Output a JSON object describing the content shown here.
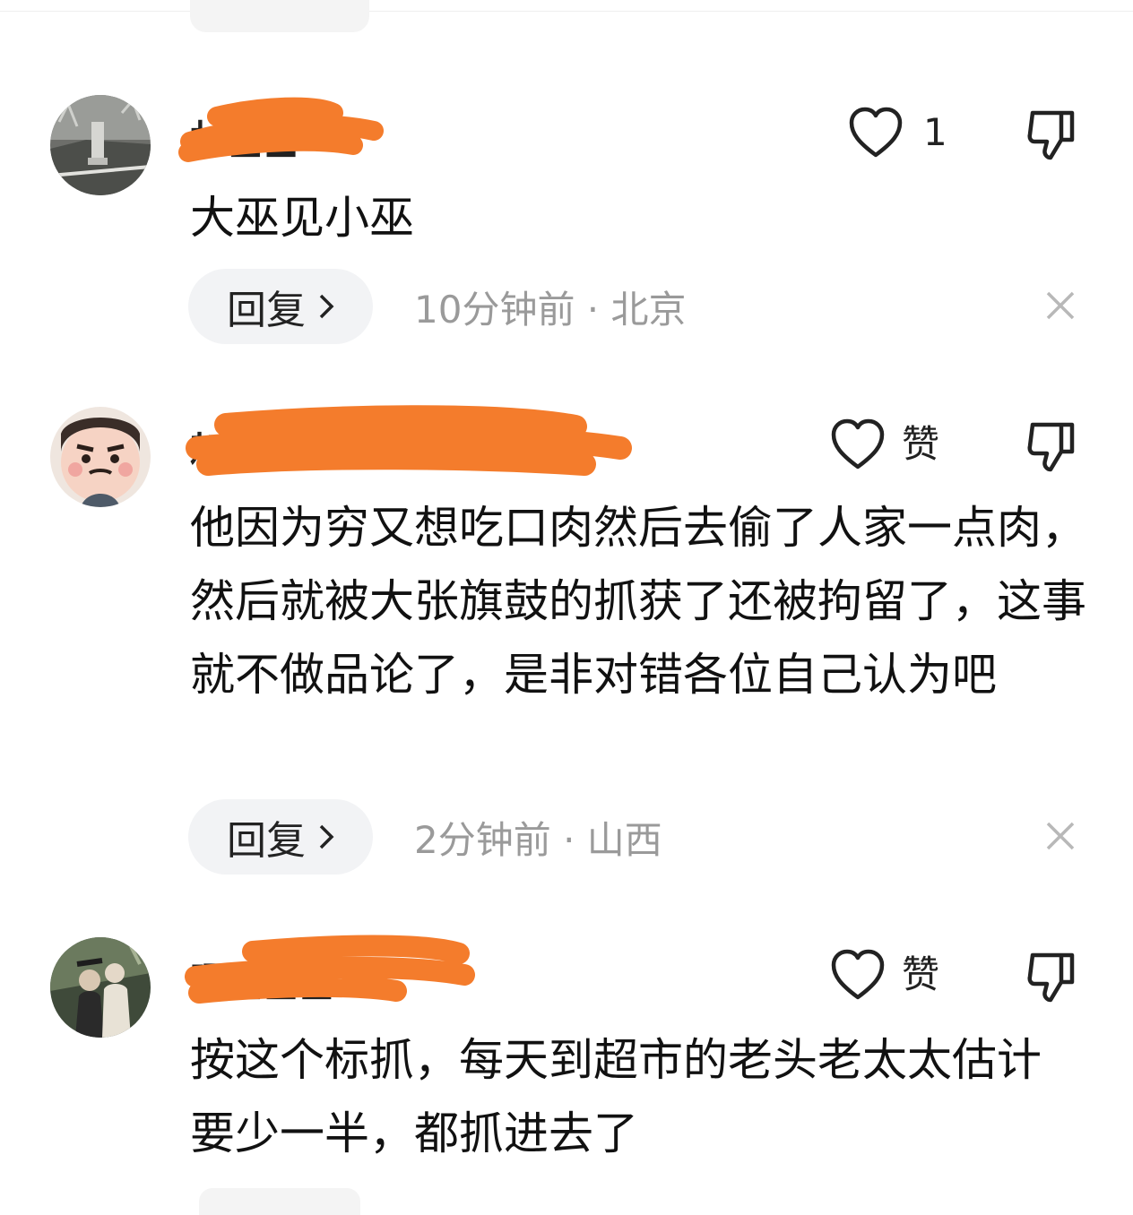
{
  "comments": [
    {
      "username": "林■■",
      "text": "大巫见小巫",
      "like_label": "1",
      "reply_label": "回复",
      "meta": "10分钟前 · 北京"
    },
    {
      "username": "耘■■■■■■■■行",
      "text": "他因为穷又想吃口肉然后去偷了人家一点肉，然后就被大张旗鼓的抓获了还被拘留了，这事就不做品论了，是非对错各位自己认为吧",
      "like_label": "赞",
      "reply_label": "回复",
      "meta": "2分钟前 · 山西"
    },
    {
      "username": "曙■■■",
      "text": "按这个标抓，每天到超市的老头老太太估计要少一半，都抓进去了",
      "like_label": "赞"
    }
  ],
  "icons": {
    "like": "heart-outline-icon",
    "dislike": "thumbs-down-icon",
    "close": "close-icon",
    "chevron": "chevron-right-icon"
  },
  "colors": {
    "redaction": "#f47c2c",
    "meta_text": "#9a9a9a",
    "reply_bg": "#f2f3f5"
  }
}
